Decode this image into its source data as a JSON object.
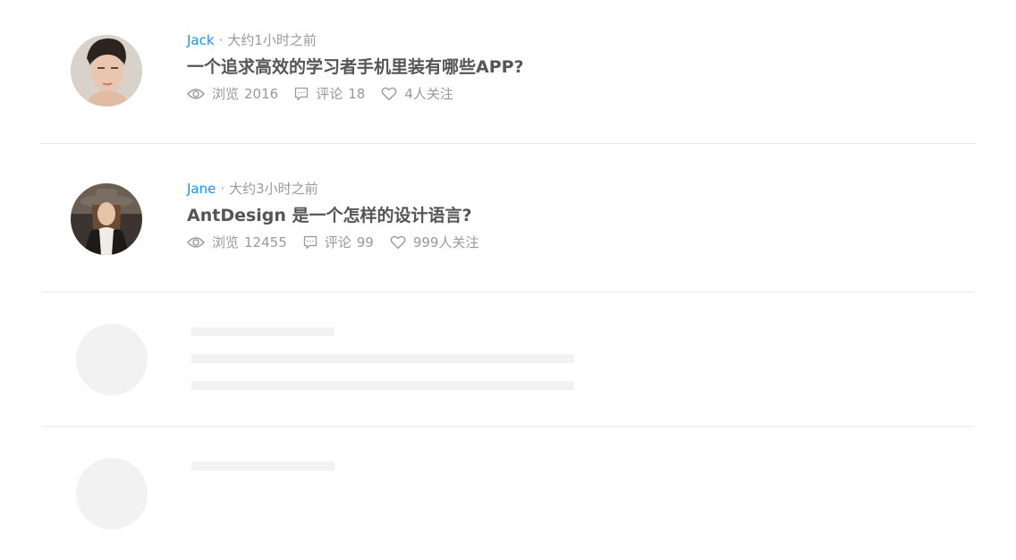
{
  "items": [
    {
      "author": "Jack",
      "time": "大约1小时之前",
      "title": "一个追求高效的学习者手机里装有哪些APP?",
      "views_label": "浏览",
      "views": "2016",
      "comments_label": "评论",
      "comments": "18",
      "followers": "4人关注"
    },
    {
      "author": "Jane",
      "time": "大约3小时之前",
      "title": "AntDesign 是一个怎样的设计语言?",
      "views_label": "浏览",
      "views": "12455",
      "comments_label": "评论",
      "comments": "99",
      "followers": "999人关注"
    }
  ],
  "icons": {
    "views": "eye-icon",
    "comments": "message-icon",
    "followers": "heart-icon"
  },
  "colors": {
    "author": "#1890ff",
    "meta": "#999999",
    "title": "#555555",
    "skeleton": "#f2f2f2",
    "divider": "#e8e8e8"
  }
}
